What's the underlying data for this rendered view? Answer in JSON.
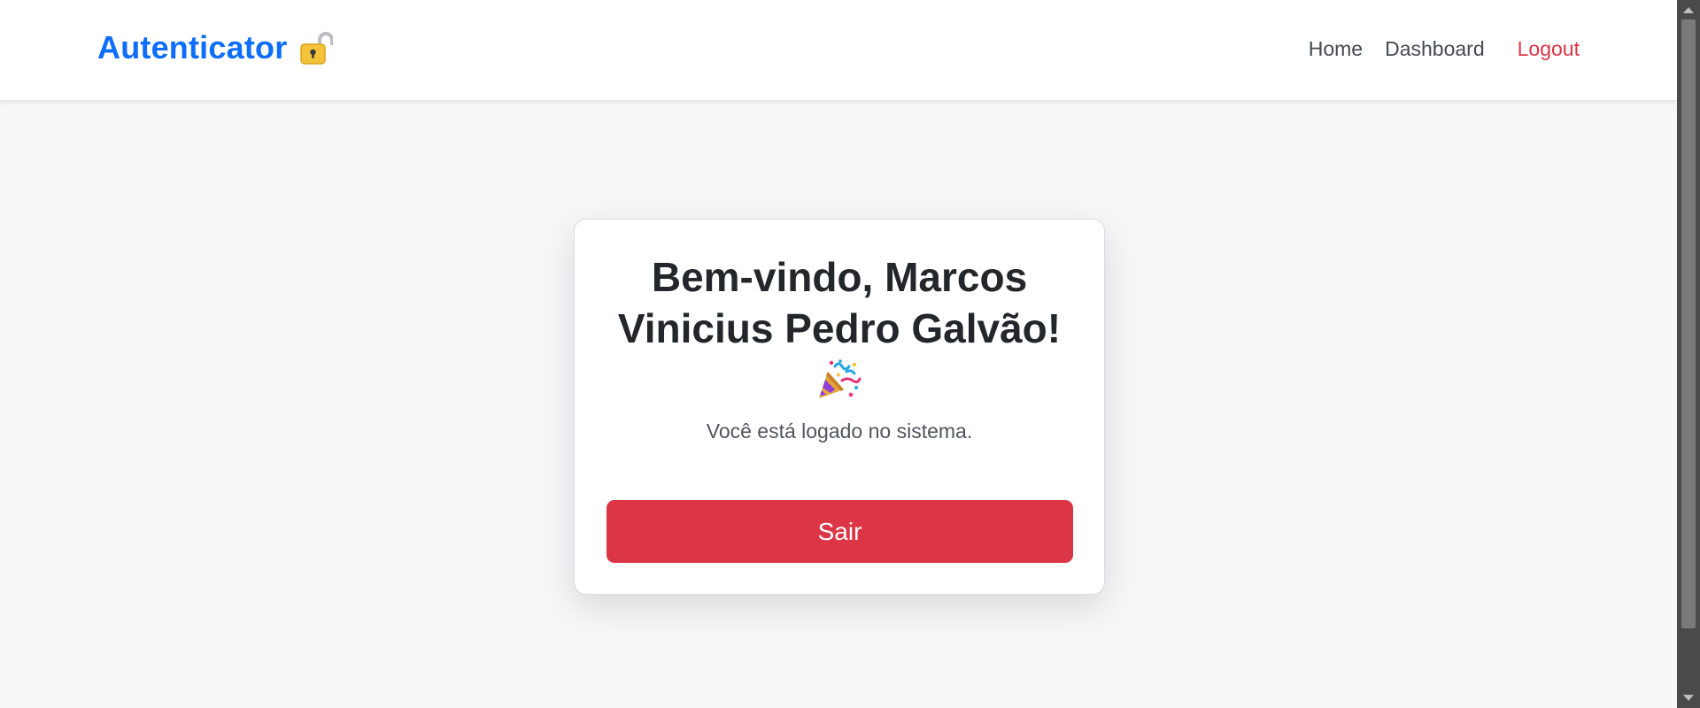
{
  "navbar": {
    "brand": "Autenticator",
    "brand_icon": "lock-icon",
    "links": {
      "home": "Home",
      "dashboard": "Dashboard",
      "logout": "Logout"
    },
    "colors": {
      "brand": "#0d6efd",
      "logout": "#dc3545"
    }
  },
  "card": {
    "title": "Bem-vindo, Marcos Vinicius Pedro Galvão!",
    "title_icon": "party-popper-icon",
    "subtitle": "Você está logado no sistema.",
    "button_label": "Sair",
    "button_color": "#dc3545"
  }
}
